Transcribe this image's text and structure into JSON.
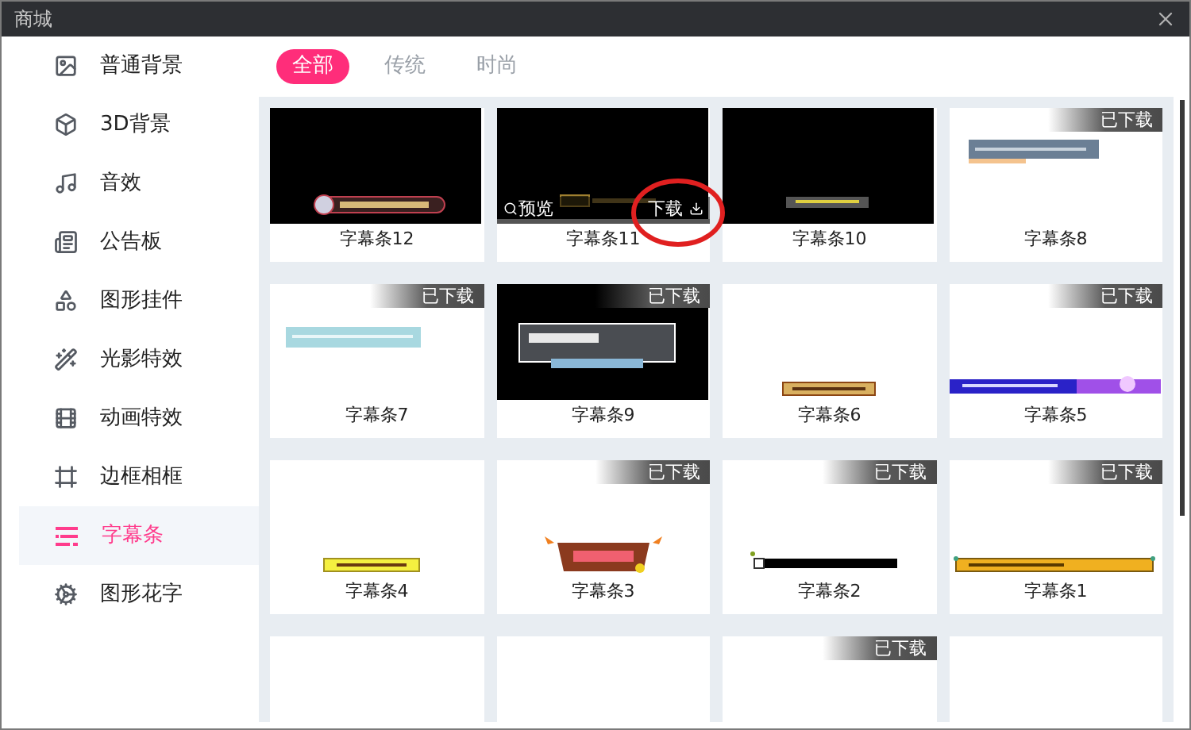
{
  "window": {
    "title": "商城"
  },
  "sidebar": {
    "items": [
      {
        "label": "普通背景",
        "selected": false
      },
      {
        "label": "3D背景",
        "selected": false
      },
      {
        "label": "音效",
        "selected": false
      },
      {
        "label": "公告板",
        "selected": false
      },
      {
        "label": "图形挂件",
        "selected": false
      },
      {
        "label": "光影特效",
        "selected": false
      },
      {
        "label": "动画特效",
        "selected": false
      },
      {
        "label": "边框相框",
        "selected": false
      },
      {
        "label": "字幕条",
        "selected": true
      },
      {
        "label": "图形花字",
        "selected": false
      }
    ]
  },
  "tabs": [
    {
      "label": "全部",
      "selected": true
    },
    {
      "label": "传统",
      "selected": false
    },
    {
      "label": "时尚",
      "selected": false
    }
  ],
  "cards": [
    {
      "kind": "caption",
      "label": "字幕条12",
      "hovered": false,
      "circled": false
    },
    {
      "kind": "caption",
      "label": "字幕条11",
      "hovered": true,
      "circled": true,
      "preview": "预览",
      "download": "下载"
    },
    {
      "kind": "caption",
      "label": "字幕条10",
      "hovered": false,
      "circled": false
    },
    {
      "kind": "caption",
      "label": "字幕条8",
      "badge": "已下载",
      "hovered": false,
      "circled": false
    },
    {
      "kind": "caption",
      "label": "字幕条7",
      "badge": "已下载",
      "hovered": false,
      "circled": false
    },
    {
      "kind": "caption",
      "label": "字幕条9",
      "badge": "已下载",
      "hovered": false,
      "circled": false
    },
    {
      "kind": "caption",
      "label": "字幕条6",
      "hovered": false,
      "circled": false
    },
    {
      "kind": "caption",
      "label": "字幕条5",
      "badge": "已下载",
      "hovered": false,
      "circled": false
    },
    {
      "kind": "caption",
      "label": "字幕条4",
      "hovered": false,
      "circled": false
    },
    {
      "kind": "caption",
      "label": "字幕条3",
      "badge": "已下载",
      "hovered": false,
      "circled": false
    },
    {
      "kind": "caption",
      "label": "字幕条2",
      "badge": "已下载",
      "hovered": false,
      "circled": false
    },
    {
      "kind": "caption",
      "label": "字幕条1",
      "badge": "已下载",
      "hovered": false,
      "circled": false
    },
    {
      "kind": "blank"
    },
    {
      "kind": "blank"
    },
    {
      "kind": "blank",
      "badge": "已下载"
    },
    {
      "kind": "blank"
    }
  ]
}
